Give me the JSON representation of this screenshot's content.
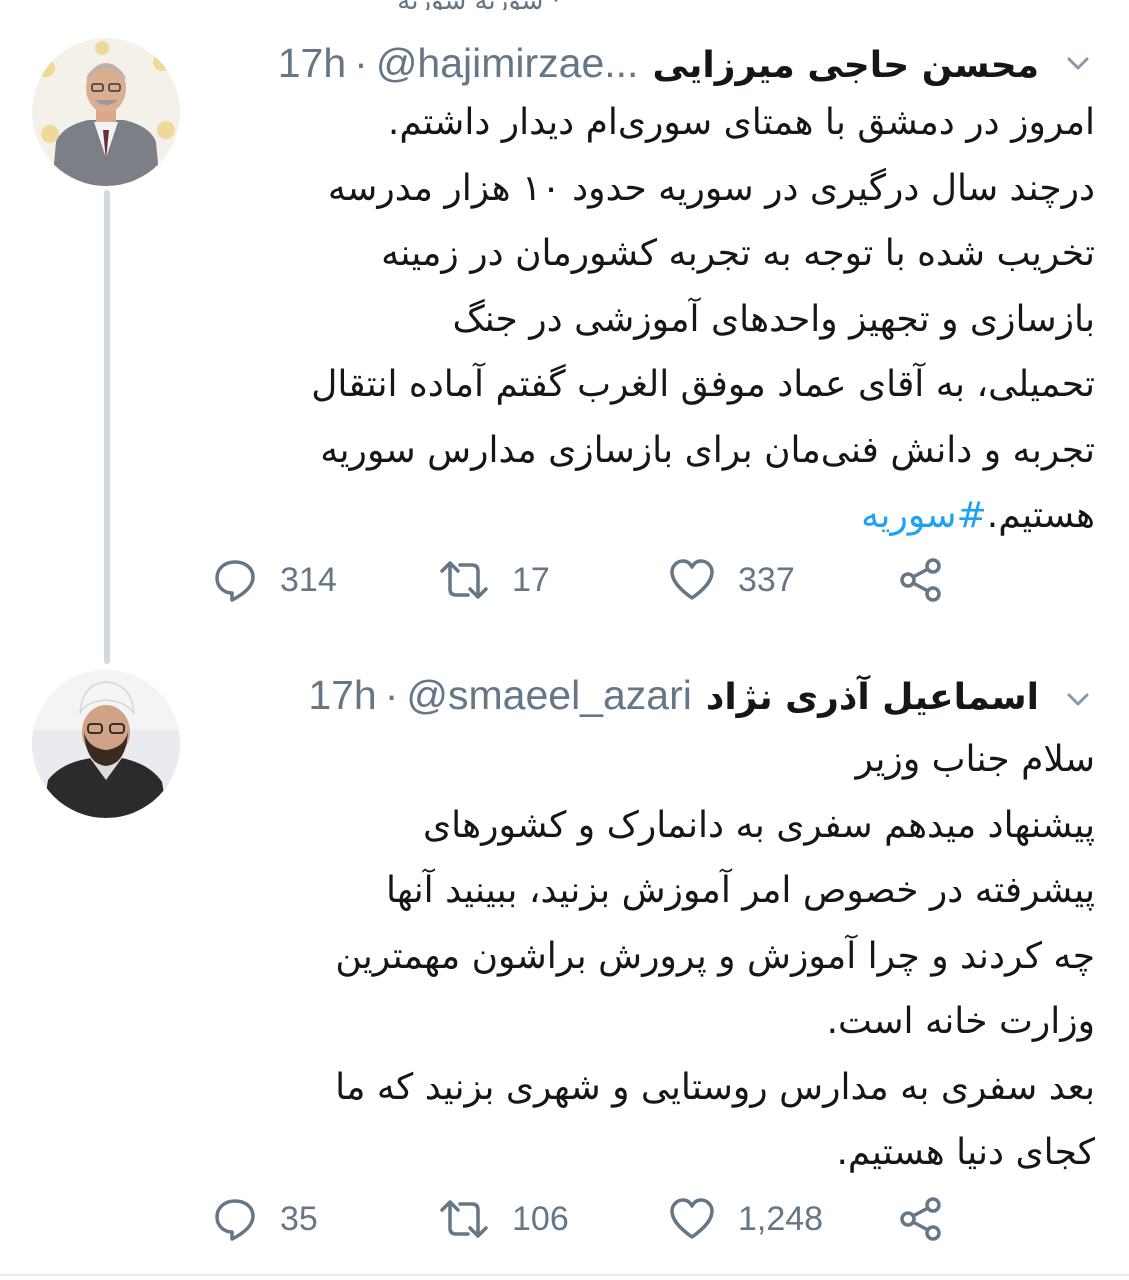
{
  "top_fragment": "· سوریه سوریه",
  "tweets": [
    {
      "display_name": "محسن حاجی میرزایی",
      "handle": "@hajimirzae...",
      "separator": "·",
      "time": "17h",
      "body_lines": [
        "امروز در دمشق با همتای سوری‌ام دیدار داشتم.",
        "درچند سال درگیری در سوریه حدود ۱۰ هزار مدرسه",
        "تخریب شده با توجه به تجربه کشورمان در زمینه",
        "بازسازی و تجهیز واحدهای آموزشی در جنگ",
        "تحمیلی، به آقای عماد موفق الغرب گفتم آماده انتقال",
        "تجربه و دانش فنی‌مان برای بازسازی مدارس سوریه"
      ],
      "last_line_text": "هستیم.",
      "hashtag": "#سوریه",
      "replies": "314",
      "retweets": "17",
      "likes": "337",
      "avatar_icon": "avatar-photo-man-suit"
    },
    {
      "display_name": "اسماعیل آذری نژاد",
      "handle": "@smaeel_azari",
      "separator": "·",
      "time": "17h",
      "body_lines": [
        "سلام جناب وزیر",
        "پیشنهاد میدهم سفری به دانمارک و کشورهای",
        "پیشرفته در خصوص امر آموزش بزنید، ببینید آنها",
        "چه کردند و چرا آموزش و پرورش براشون مهمترین",
        "وزارت خانه است.",
        "بعد سفری به مدارس روستایی و شهری بزنید که ما",
        "کجای دنیا هستیم."
      ],
      "replies": "35",
      "retweets": "106",
      "likes": "1,248",
      "avatar_icon": "avatar-photo-cleric"
    }
  ],
  "colors": {
    "text": "#14171a",
    "secondary": "#657786",
    "link": "#1da1f2",
    "thread_line": "#cfd9de"
  },
  "icons": [
    "reply-icon",
    "retweet-icon",
    "like-icon",
    "share-icon",
    "chevron-down-icon"
  ]
}
